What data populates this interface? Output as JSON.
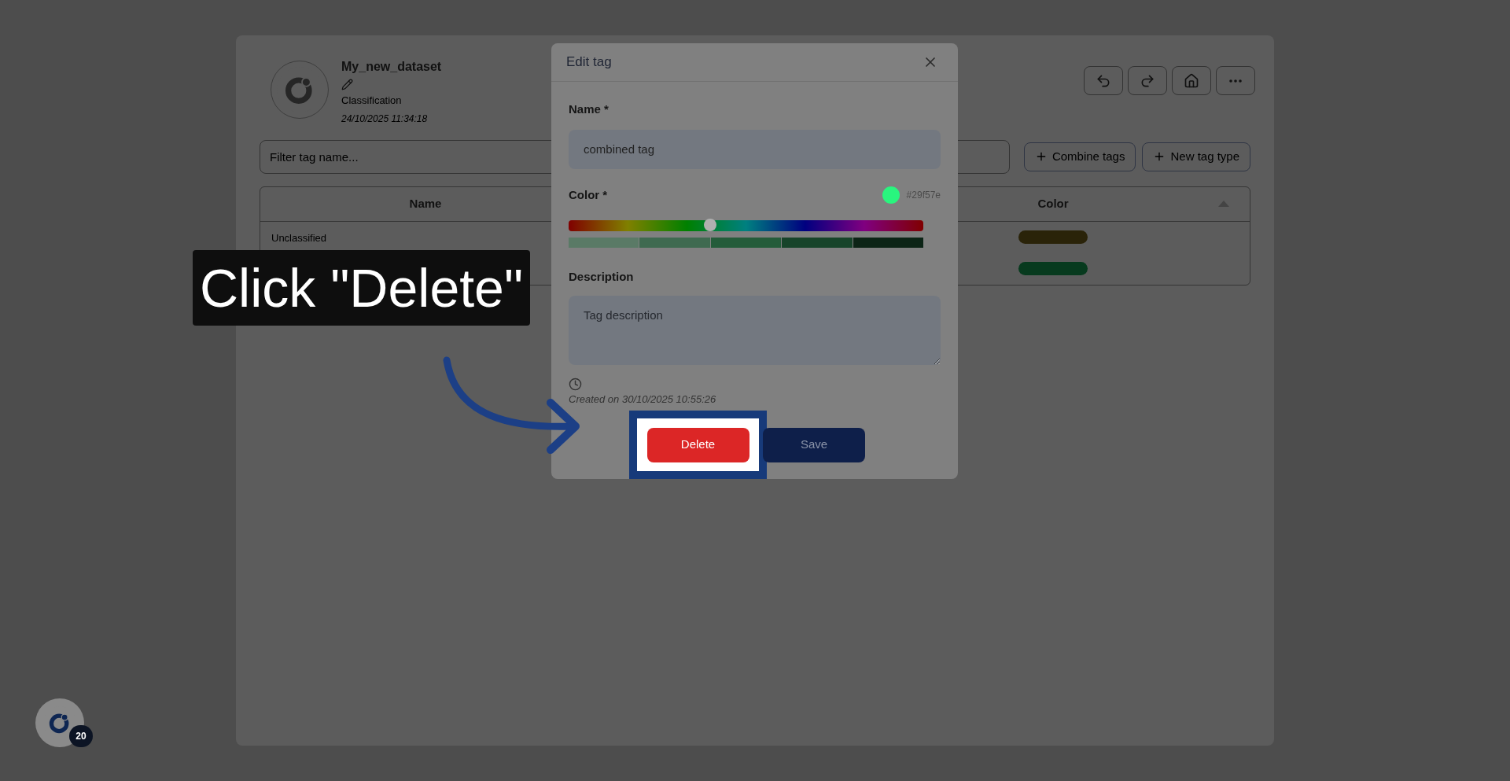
{
  "dataset": {
    "title": "My_new_dataset",
    "type": "Classification",
    "date": "24/10/2025 11:34:18"
  },
  "filter": {
    "placeholder": "Filter tag name..."
  },
  "actions": [
    {
      "label": "Combine tags"
    },
    {
      "label": "New tag type"
    }
  ],
  "table": {
    "columns": [
      "Name",
      "Color"
    ],
    "rows": [
      {
        "name": "Unclassified",
        "color": "#2a2309"
      },
      {
        "color": "#073a1e"
      }
    ]
  },
  "modal": {
    "title": "Edit tag",
    "name_label": "Name *",
    "name_value": "combined tag",
    "color_label": "Color *",
    "hex": "#29f57e",
    "hue": {
      "level": 0.4
    },
    "description_label": "Description",
    "description_placeholder": "Tag description",
    "created": "Created on 30/10/2025 10:55:26",
    "buttons": [
      {
        "label": "Delete",
        "kind": "danger"
      },
      {
        "label": "Save",
        "kind": "primary"
      }
    ]
  },
  "callout": {
    "text": "Click \"Delete\""
  },
  "assistant": {
    "count": "20"
  }
}
